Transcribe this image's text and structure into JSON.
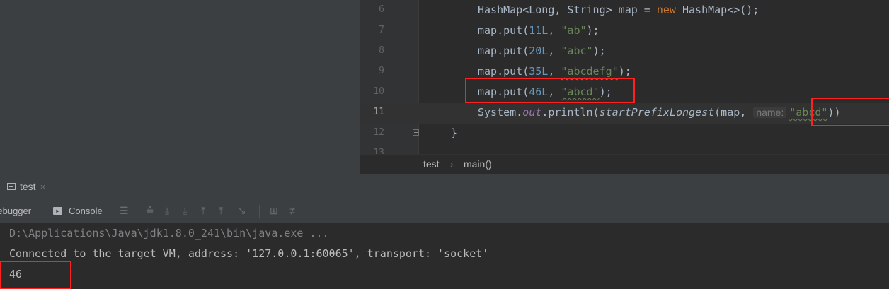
{
  "editor": {
    "lines": [
      {
        "number": "6",
        "tokens": [
          {
            "t": "HashMap<Long, String> map = ",
            "c": ""
          },
          {
            "t": "new",
            "c": "kw"
          },
          {
            "t": " HashMap<>();",
            "c": ""
          }
        ]
      },
      {
        "number": "7",
        "tokens": [
          {
            "t": "map.put(",
            "c": ""
          },
          {
            "t": "11L",
            "c": "num"
          },
          {
            "t": ", ",
            "c": ""
          },
          {
            "t": "\"ab\"",
            "c": "str"
          },
          {
            "t": ");",
            "c": ""
          }
        ]
      },
      {
        "number": "8",
        "tokens": [
          {
            "t": "map.put(",
            "c": ""
          },
          {
            "t": "20L",
            "c": "num"
          },
          {
            "t": ", ",
            "c": ""
          },
          {
            "t": "\"abc\"",
            "c": "str"
          },
          {
            "t": ");",
            "c": ""
          }
        ]
      },
      {
        "number": "9",
        "tokens": [
          {
            "t": "map.put(",
            "c": ""
          },
          {
            "t": "35L",
            "c": "num"
          },
          {
            "t": ", ",
            "c": ""
          },
          {
            "t": "\"abcdefg\"",
            "c": "str squig"
          },
          {
            "t": ");",
            "c": ""
          }
        ]
      },
      {
        "number": "10",
        "tokens": [
          {
            "t": "map.put(",
            "c": ""
          },
          {
            "t": "46L",
            "c": "num"
          },
          {
            "t": ", ",
            "c": ""
          },
          {
            "t": "\"abcd\"",
            "c": "str squig"
          },
          {
            "t": ");",
            "c": ""
          }
        ]
      },
      {
        "number": "11",
        "caret": true,
        "tokens": [
          {
            "t": "System.",
            "c": ""
          },
          {
            "t": "out",
            "c": "fld"
          },
          {
            "t": ".println(",
            "c": ""
          },
          {
            "t": "startPrefixLongest",
            "c": "it"
          },
          {
            "t": "(map,",
            "c": ""
          },
          {
            "t": "name:",
            "c": "hint"
          },
          {
            "t": "\"abcd\"",
            "c": "str squig"
          },
          {
            "t": "))",
            "c": ""
          }
        ]
      },
      {
        "number": "12",
        "fold": true,
        "tokens": [
          {
            "t": "}",
            "c": ""
          }
        ]
      },
      {
        "number": "13",
        "tokens": []
      }
    ]
  },
  "breadcrumb": {
    "class_name": "test",
    "separator": "›",
    "method": "main()"
  },
  "run_panel": {
    "tab_label": "test",
    "close_glyph": "×",
    "debugger_label": "Debugger",
    "console_label": "Console",
    "console_icon": "console-icon",
    "toolbar_icons": [
      "menu-icon",
      "show-execution-point-icon",
      "step-over-icon",
      "step-into-icon",
      "force-step-into-icon",
      "step-out-icon",
      "run-to-cursor-icon",
      "evaluate-expression-icon",
      "trace-icon"
    ]
  },
  "console": {
    "lines": [
      "D:\\Applications\\Java\\jdk1.8.0_241\\bin\\java.exe ...",
      "Connected to the target VM, address: '127.0.0.1:60065', transport: 'socket'",
      "46"
    ]
  },
  "colors": {
    "keyword": "#cc7832",
    "number": "#6897bb",
    "string": "#6a8759",
    "field": "#9876aa",
    "highlight_box": "#ff2020",
    "background": "#2b2b2b",
    "panel": "#3c3f41"
  }
}
